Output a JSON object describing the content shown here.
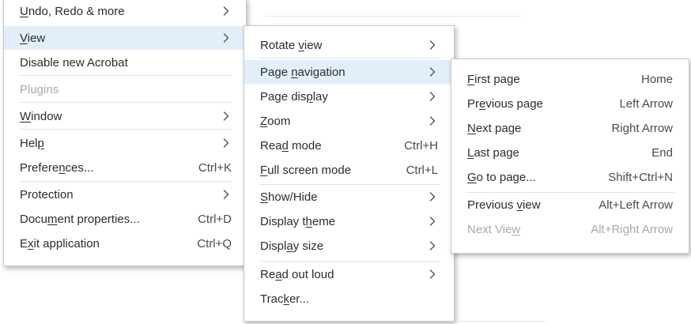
{
  "main_menu": {
    "items": [
      {
        "pre": "",
        "ul": "U",
        "post": "ndo, Redo & more",
        "shortcut": "",
        "submenu": true,
        "disabled": false,
        "highlighted": false
      },
      {
        "pre": "",
        "ul": "V",
        "post": "iew",
        "shortcut": "",
        "submenu": true,
        "disabled": false,
        "highlighted": true
      },
      {
        "pre": "Disable new Acrobat",
        "ul": "",
        "post": "",
        "shortcut": "",
        "submenu": false,
        "disabled": false,
        "highlighted": false
      },
      {
        "pre": "Plugins",
        "ul": "",
        "post": "",
        "shortcut": "",
        "submenu": false,
        "disabled": true,
        "highlighted": false
      },
      {
        "pre": "",
        "ul": "W",
        "post": "indow",
        "shortcut": "",
        "submenu": true,
        "disabled": false,
        "highlighted": false
      },
      {
        "pre": "Hel",
        "ul": "p",
        "post": "",
        "shortcut": "",
        "submenu": true,
        "disabled": false,
        "highlighted": false
      },
      {
        "pre": "Prefere",
        "ul": "n",
        "post": "ces...",
        "shortcut": "Ctrl+K",
        "submenu": false,
        "disabled": false,
        "highlighted": false
      },
      {
        "pre": "Protection",
        "ul": "",
        "post": "",
        "shortcut": "",
        "submenu": true,
        "disabled": false,
        "highlighted": false
      },
      {
        "pre": "Docu",
        "ul": "m",
        "post": "ent properties...",
        "shortcut": "Ctrl+D",
        "submenu": false,
        "disabled": false,
        "highlighted": false
      },
      {
        "pre": "E",
        "ul": "x",
        "post": "it application",
        "shortcut": "Ctrl+Q",
        "submenu": false,
        "disabled": false,
        "highlighted": false
      }
    ]
  },
  "view_menu": {
    "items": [
      {
        "pre": "Rotate ",
        "ul": "v",
        "post": "iew",
        "shortcut": "",
        "submenu": true,
        "disabled": false,
        "highlighted": false
      },
      {
        "pre": "Page ",
        "ul": "n",
        "post": "avigation",
        "shortcut": "",
        "submenu": true,
        "disabled": false,
        "highlighted": true
      },
      {
        "pre": "Page dis",
        "ul": "p",
        "post": "lay",
        "shortcut": "",
        "submenu": true,
        "disabled": false,
        "highlighted": false
      },
      {
        "pre": "",
        "ul": "Z",
        "post": "oom",
        "shortcut": "",
        "submenu": true,
        "disabled": false,
        "highlighted": false
      },
      {
        "pre": "Rea",
        "ul": "d",
        "post": " mode",
        "shortcut": "Ctrl+H",
        "submenu": false,
        "disabled": false,
        "highlighted": false
      },
      {
        "pre": "",
        "ul": "F",
        "post": "ull screen mode",
        "shortcut": "Ctrl+L",
        "submenu": false,
        "disabled": false,
        "highlighted": false
      },
      {
        "pre": "",
        "ul": "S",
        "post": "how/Hide",
        "shortcut": "",
        "submenu": true,
        "disabled": false,
        "highlighted": false
      },
      {
        "pre": "Display t",
        "ul": "h",
        "post": "eme",
        "shortcut": "",
        "submenu": true,
        "disabled": false,
        "highlighted": false
      },
      {
        "pre": "Displ",
        "ul": "a",
        "post": "y size",
        "shortcut": "",
        "submenu": true,
        "disabled": false,
        "highlighted": false
      },
      {
        "pre": "Re",
        "ul": "a",
        "post": "d out loud",
        "shortcut": "",
        "submenu": true,
        "disabled": false,
        "highlighted": false
      },
      {
        "pre": "Trac",
        "ul": "k",
        "post": "er...",
        "shortcut": "",
        "submenu": false,
        "disabled": false,
        "highlighted": false
      }
    ]
  },
  "page_navigation_menu": {
    "items": [
      {
        "pre": "",
        "ul": "F",
        "post": "irst page",
        "shortcut": "Home",
        "submenu": false,
        "disabled": false,
        "highlighted": false
      },
      {
        "pre": "Pr",
        "ul": "e",
        "post": "vious page",
        "shortcut": "Left Arrow",
        "submenu": false,
        "disabled": false,
        "highlighted": false
      },
      {
        "pre": "",
        "ul": "N",
        "post": "ext page",
        "shortcut": "Right Arrow",
        "submenu": false,
        "disabled": false,
        "highlighted": false
      },
      {
        "pre": "",
        "ul": "L",
        "post": "ast page",
        "shortcut": "End",
        "submenu": false,
        "disabled": false,
        "highlighted": false
      },
      {
        "pre": "",
        "ul": "G",
        "post": "o to page...",
        "shortcut": "Shift+Ctrl+N",
        "submenu": false,
        "disabled": false,
        "highlighted": false
      },
      {
        "pre": "Previous ",
        "ul": "v",
        "post": "iew",
        "shortcut": "Alt+Left Arrow",
        "submenu": false,
        "disabled": false,
        "highlighted": false
      },
      {
        "pre": "Next Vie",
        "ul": "w",
        "post": "",
        "shortcut": "Alt+Right Arrow",
        "submenu": false,
        "disabled": true,
        "highlighted": false
      }
    ]
  },
  "icons": {
    "submenu_arrow": "chevron-right-icon"
  },
  "colors": {
    "highlight": "#e3eefb",
    "text": "#2c2c2c",
    "disabled_text": "#a9a9a9",
    "separator": "#e2e2e2"
  }
}
